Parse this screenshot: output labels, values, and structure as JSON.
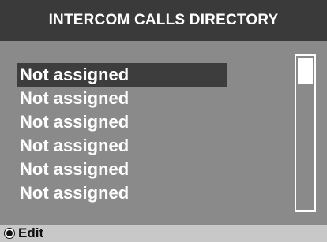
{
  "header": {
    "title": "INTERCOM CALLS DIRECTORY"
  },
  "directory": {
    "selected_index": 0,
    "entries": [
      {
        "label": "Not assigned"
      },
      {
        "label": "Not assigned"
      },
      {
        "label": "Not assigned"
      },
      {
        "label": "Not assigned"
      },
      {
        "label": "Not assigned"
      },
      {
        "label": "Not assigned"
      }
    ]
  },
  "footer": {
    "soft_key_icon": "select-key-icon",
    "soft_key_label": "Edit"
  },
  "colors": {
    "background": "#8a8a8a",
    "header_background": "#3a3a3a",
    "selected_row": "#3d3d3d",
    "footer_background": "#c8c8c8",
    "text": "#ffffff"
  }
}
